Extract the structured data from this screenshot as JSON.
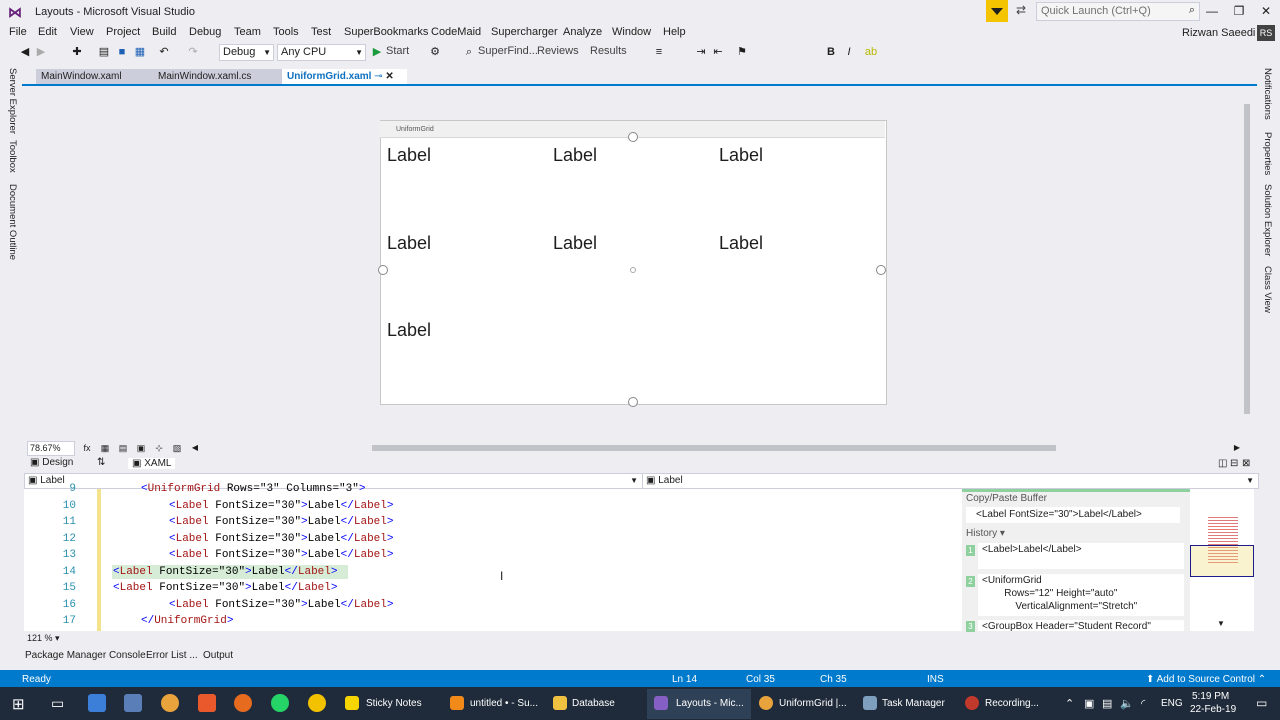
{
  "window": {
    "title": "Layouts - Microsoft Visual Studio",
    "quick_launch_placeholder": "Quick Launch (Ctrl+Q)"
  },
  "menu": [
    "File",
    "Edit",
    "View",
    "Project",
    "Build",
    "Debug",
    "Team",
    "Tools",
    "Test",
    "SuperBookmarks",
    "CodeMaid",
    "Supercharger",
    "Analyze",
    "Window",
    "Help"
  ],
  "user": {
    "name": "Rizwan Saeedi",
    "initials": "RS"
  },
  "toolbar": {
    "config": "Debug",
    "platform": "Any CPU",
    "start": "Start",
    "superfind": "SuperFind...",
    "reviews": "Reviews",
    "results": "Results"
  },
  "left_panels": [
    "Server Explorer",
    "Toolbox",
    "Document Outline"
  ],
  "right_panels": [
    "Notifications",
    "Properties",
    "Solution Explorer",
    "Class View"
  ],
  "doc_tabs": [
    {
      "label": "MainWindow.xaml",
      "active": false
    },
    {
      "label": "MainWindow.xaml.cs",
      "active": false
    },
    {
      "label": "UniformGrid.xaml",
      "active": true
    }
  ],
  "designer": {
    "container_label": "UniformGrid",
    "labels": [
      "Label",
      "Label",
      "Label",
      "Label",
      "Label",
      "Label",
      "Label"
    ],
    "zoom": "78.67%"
  },
  "view_tabs": {
    "design": "Design",
    "xaml": "XAML"
  },
  "nav": {
    "left": "Label",
    "right": "Label"
  },
  "code": {
    "lines": [
      {
        "num": "9",
        "text": "<UniformGrid Rows=\"3\" Columns=\"3\">"
      },
      {
        "num": "10",
        "text": "<Label FontSize=\"30\">Label</Label>"
      },
      {
        "num": "11",
        "text": "<Label FontSize=\"30\">Label</Label>"
      },
      {
        "num": "12",
        "text": "<Label FontSize=\"30\">Label</Label>"
      },
      {
        "num": "13",
        "text": "<Label FontSize=\"30\">Label</Label>"
      },
      {
        "num": "14",
        "text": "<Label FontSize=\"30\">Label</Label>"
      },
      {
        "num": "15",
        "text": "<Label FontSize=\"30\">Label</Label>"
      },
      {
        "num": "16",
        "text": "<Label FontSize=\"30\">Label</Label>"
      },
      {
        "num": "17",
        "text": "</UniformGrid>"
      }
    ],
    "zoom": "121 %"
  },
  "copy_paste": {
    "title": "Copy/Paste Buffer",
    "buffer": "<Label FontSize=\"30\">Label</Label>",
    "history_title": "History",
    "history": [
      {
        "num": "1",
        "text": "<Label>Label</Label>"
      },
      {
        "num": "2",
        "text": "<UniformGrid\n        Rows=\"12\" Height=\"auto\"\n            VerticalAlignment=\"Stretch\""
      },
      {
        "num": "3",
        "text": "<GroupBox Header=\"Student Record\""
      }
    ]
  },
  "bottom_tabs": [
    "Package Manager Console",
    "Error List ...",
    "Output"
  ],
  "status": {
    "ready": "Ready",
    "ln": "Ln 14",
    "col": "Col 35",
    "ch": "Ch 35",
    "ins": "INS",
    "source_control": "Add to Source Control"
  },
  "taskbar": {
    "apps": [
      "Sticky Notes",
      "untitled • - Su...",
      "Database",
      "Layouts - Mic...",
      "UniformGrid |...",
      "Task Manager",
      "Recording..."
    ],
    "lang": "ENG",
    "time": "5:19 PM",
    "date": "22-Feb-19"
  },
  "colors": {
    "accent": "#007acc",
    "tag": "#a31515",
    "attr": "#ff0000",
    "value": "#0000ff"
  }
}
